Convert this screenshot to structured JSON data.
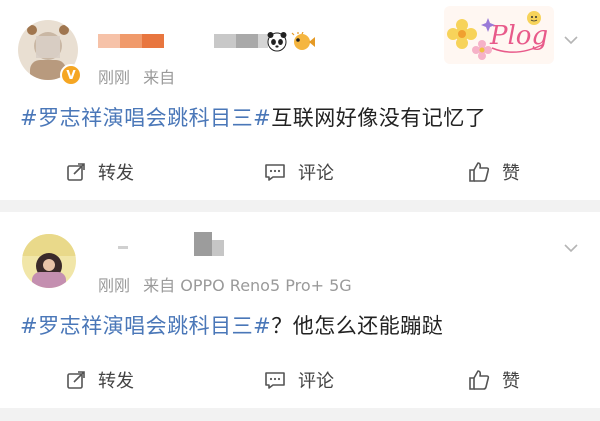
{
  "colors": {
    "hashtag": "#4a77b8",
    "meta_text": "#9a9a9a",
    "badge": "#f5a623",
    "separator": "#f2f2f2"
  },
  "posts": [
    {
      "time": "刚刚",
      "source_prefix": "来自",
      "source_device": "",
      "hashtag": "#罗志祥演唱会跳科目三#",
      "text": "互联网好像没有记忆了",
      "verified_icon": "verified-badge-icon",
      "name_emojis": [
        "panda-emoji-icon",
        "pufferfish-emoji-icon"
      ],
      "decoration_icon": "plog-sticker-icon",
      "actions": {
        "repost": "转发",
        "comment": "评论",
        "like": "赞"
      }
    },
    {
      "time": "刚刚",
      "source_prefix": "来自",
      "source_device": "OPPO Reno5 Pro+ 5G",
      "hashtag": "#罗志祥演唱会跳科目三#",
      "text": "？他怎么还能蹦跶",
      "actions": {
        "repost": "转发",
        "comment": "评论",
        "like": "赞"
      }
    }
  ]
}
